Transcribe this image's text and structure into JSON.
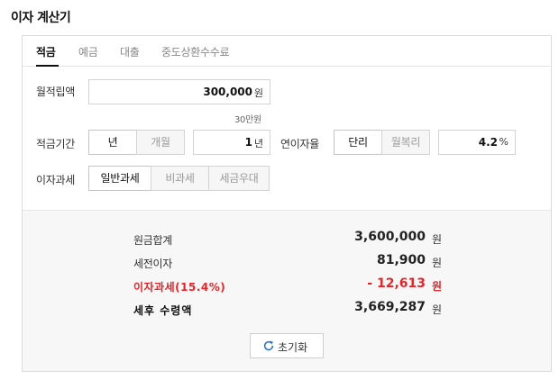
{
  "page_title": "이자 계산기",
  "tabs": [
    {
      "label": "적금",
      "active": true
    },
    {
      "label": "예금",
      "active": false
    },
    {
      "label": "대출",
      "active": false
    },
    {
      "label": "중도상환수수료",
      "active": false
    }
  ],
  "monthly_deposit": {
    "label": "월적립액",
    "value": "300,000",
    "unit": "원",
    "hint": "30만원"
  },
  "period": {
    "label": "적금기간",
    "options": [
      "년",
      "개월"
    ],
    "selected": "년",
    "value": "1",
    "unit": "년"
  },
  "rate": {
    "label": "연이자율",
    "options": [
      "단리",
      "월복리"
    ],
    "selected": "단리",
    "value": "4.2",
    "unit": "%"
  },
  "tax": {
    "label": "이자과세",
    "options": [
      "일반과세",
      "비과세",
      "세금우대"
    ],
    "selected": "일반과세"
  },
  "results": {
    "principal": {
      "label": "원금합계",
      "value": "3,600,000",
      "unit": "원"
    },
    "pretax_interest": {
      "label": "세전이자",
      "value": "81,900",
      "unit": "원"
    },
    "interest_tax": {
      "label": "이자과세(15.4%)",
      "value": "- 12,613",
      "unit": "원"
    },
    "after_tax": {
      "label": "세후 수령액",
      "value": "3,669,287",
      "unit": "원"
    }
  },
  "reset_label": "초기화",
  "colors": {
    "accent_red": "#e3262c",
    "refresh_icon": "#2b6fd6"
  }
}
